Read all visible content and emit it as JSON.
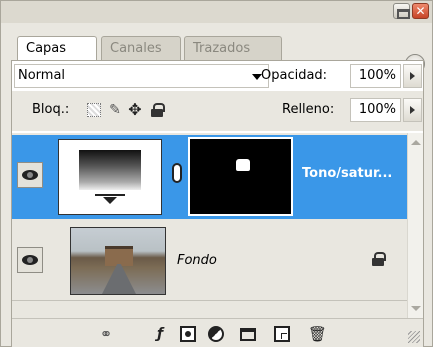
{
  "window": {
    "minimize_glyph": "",
    "close_glyph": "✕"
  },
  "tabs": [
    {
      "label": "Capas",
      "active": true
    },
    {
      "label": "Canales",
      "active": false
    },
    {
      "label": "Trazados",
      "active": false
    }
  ],
  "tab_menu_glyph": "▸",
  "blend_mode": {
    "value": "Normal"
  },
  "opacity": {
    "label": "Opacidad:",
    "value": "100%"
  },
  "lock": {
    "label": "Bloq.:"
  },
  "fill": {
    "label": "Relleno:",
    "value": "100%"
  },
  "layers": [
    {
      "name": "Tono/satur...",
      "selected": true,
      "visible": true,
      "type": "adjustment"
    },
    {
      "name": "Fondo",
      "selected": false,
      "visible": true,
      "type": "background",
      "locked": true
    }
  ],
  "colors": {
    "selection": "#3a97e8",
    "panel_bg": "#e9e7e0",
    "close_button": "#c64427"
  },
  "icons": {
    "lock_move": "✥",
    "lock_brush": "✎",
    "lock_all": "🔒",
    "link": "⚭",
    "fx": "ƒ",
    "trash": "🗑"
  }
}
